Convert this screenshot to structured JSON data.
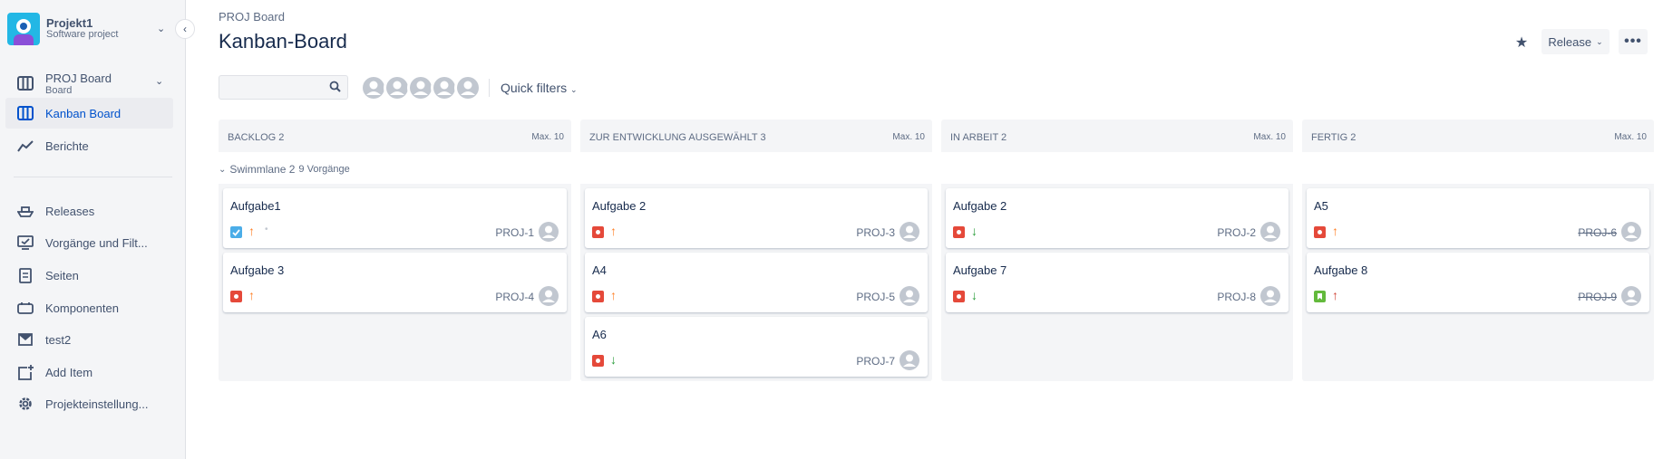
{
  "sidebar": {
    "project": {
      "name": "Projekt1",
      "type": "Software project"
    },
    "board": {
      "name": "PROJ Board",
      "sub": "Board"
    },
    "items": [
      {
        "label": "Kanban Board",
        "icon": "board-icon",
        "active": true
      },
      {
        "label": "Berichte",
        "icon": "chart-icon"
      },
      {
        "label": "Releases",
        "icon": "ship-icon"
      },
      {
        "label": "Vorgänge und Filt...",
        "icon": "issues-icon"
      },
      {
        "label": "Seiten",
        "icon": "page-icon"
      },
      {
        "label": "Komponenten",
        "icon": "component-icon"
      },
      {
        "label": "test2",
        "icon": "shortcut-icon"
      },
      {
        "label": "Add Item",
        "icon": "add-item-icon"
      },
      {
        "label": "Projekteinstellung...",
        "icon": "gear-icon"
      }
    ]
  },
  "header": {
    "breadcrumb": "PROJ Board",
    "title": "Kanban-Board",
    "release_label": "Release",
    "more_label": "•••"
  },
  "filters": {
    "search_placeholder": "",
    "quick_filters": "Quick filters"
  },
  "swimlane": {
    "label": "Swimmlane 2",
    "count": "9 Vorgänge"
  },
  "columns": [
    {
      "title": "BACKLOG 2",
      "max": "Max. 10",
      "cards": [
        {
          "title": "Aufgabe1",
          "type": "task",
          "priority": "up",
          "key": "PROJ-1",
          "done": false,
          "estimate": "•"
        },
        {
          "title": "Aufgabe 3",
          "type": "bug",
          "priority": "up",
          "key": "PROJ-4",
          "done": false
        }
      ]
    },
    {
      "title": "ZUR ENTWICKLUNG AUSGEWÄHLT 3",
      "max": "Max. 10",
      "cards": [
        {
          "title": "Aufgabe 2",
          "type": "bug",
          "priority": "up",
          "key": "PROJ-3",
          "done": false
        },
        {
          "title": "A4",
          "type": "bug",
          "priority": "up",
          "key": "PROJ-5",
          "done": false
        },
        {
          "title": "A6",
          "type": "bug",
          "priority": "down",
          "key": "PROJ-7",
          "done": false
        }
      ]
    },
    {
      "title": "IN ARBEIT 2",
      "max": "Max. 10",
      "cards": [
        {
          "title": "Aufgabe 2",
          "type": "bug",
          "priority": "down",
          "key": "PROJ-2",
          "done": false
        },
        {
          "title": "Aufgabe 7",
          "type": "bug",
          "priority": "down",
          "key": "PROJ-8",
          "done": false
        }
      ]
    },
    {
      "title": "FERTIG 2",
      "max": "Max. 10",
      "cards": [
        {
          "title": "A5",
          "type": "bug",
          "priority": "up",
          "key": "PROJ-6",
          "done": true
        },
        {
          "title": "Aufgabe 8",
          "type": "story",
          "priority": "high",
          "key": "PROJ-9",
          "done": true
        }
      ]
    }
  ],
  "colors": {
    "accent": "#0052cc",
    "bug": "#e5493a",
    "task": "#4bade8",
    "story": "#63ba3c",
    "prio_up": "#ff7f25",
    "prio_down": "#2a9d3a",
    "prio_high": "#d04437"
  }
}
